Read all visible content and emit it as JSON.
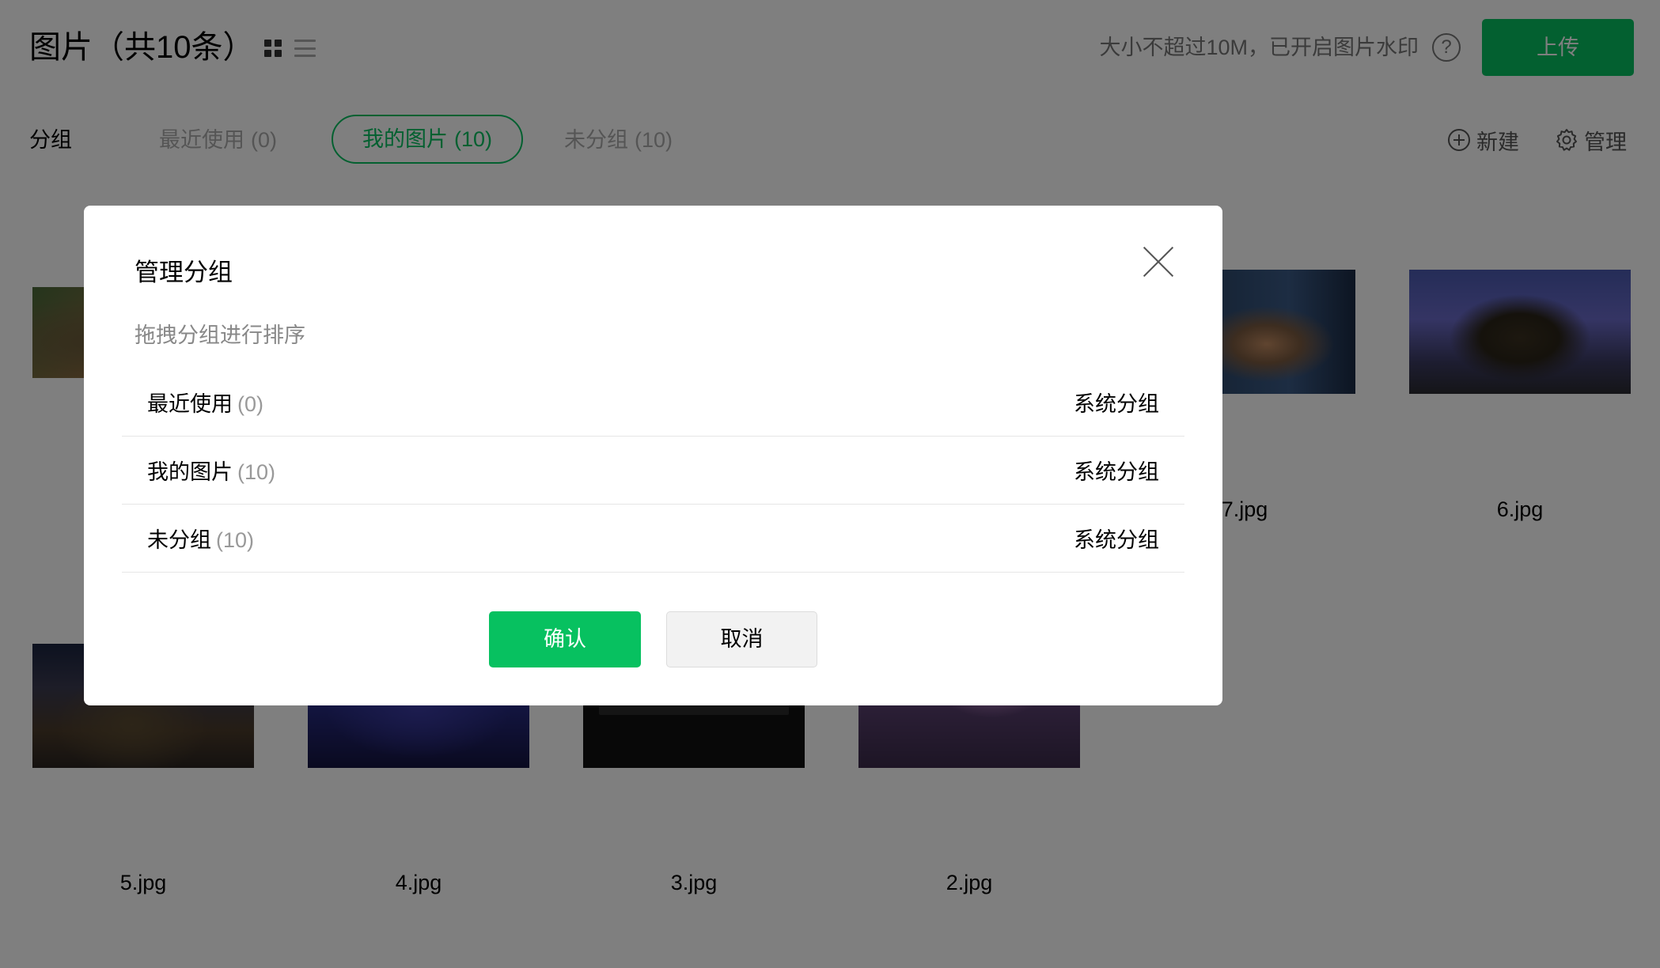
{
  "header": {
    "title": "图片（共10条）",
    "size_note": "大小不超过10M，已开启图片水印",
    "help_icon": "?",
    "upload_label": "上传"
  },
  "groups_bar": {
    "label": "分组",
    "tabs": [
      {
        "name": "最近使用",
        "count": "(0)",
        "active": false
      },
      {
        "name": "我的图片",
        "count": "(10)",
        "active": true
      },
      {
        "name": "未分组",
        "count": "(10)",
        "active": false
      }
    ],
    "new_label": "新建",
    "manage_label": "管理"
  },
  "images": {
    "row1": [
      {
        "label": "7.jpg"
      },
      {
        "label": "6.jpg"
      }
    ],
    "row2": [
      {
        "label": "5.jpg"
      },
      {
        "label": "4.jpg"
      },
      {
        "label": "3.jpg"
      },
      {
        "label": "2.jpg"
      }
    ]
  },
  "modal": {
    "title": "管理分组",
    "hint": "拖拽分组进行排序",
    "groups": [
      {
        "name": "最近使用",
        "count": "(0)",
        "type": "系统分组"
      },
      {
        "name": "我的图片",
        "count": "(10)",
        "type": "系统分组"
      },
      {
        "name": "未分组",
        "count": "(10)",
        "type": "系统分组"
      }
    ],
    "confirm_label": "确认",
    "cancel_label": "取消"
  },
  "colors": {
    "accent": "#07c160",
    "mask": "rgba(0,0,0,0.5)"
  }
}
